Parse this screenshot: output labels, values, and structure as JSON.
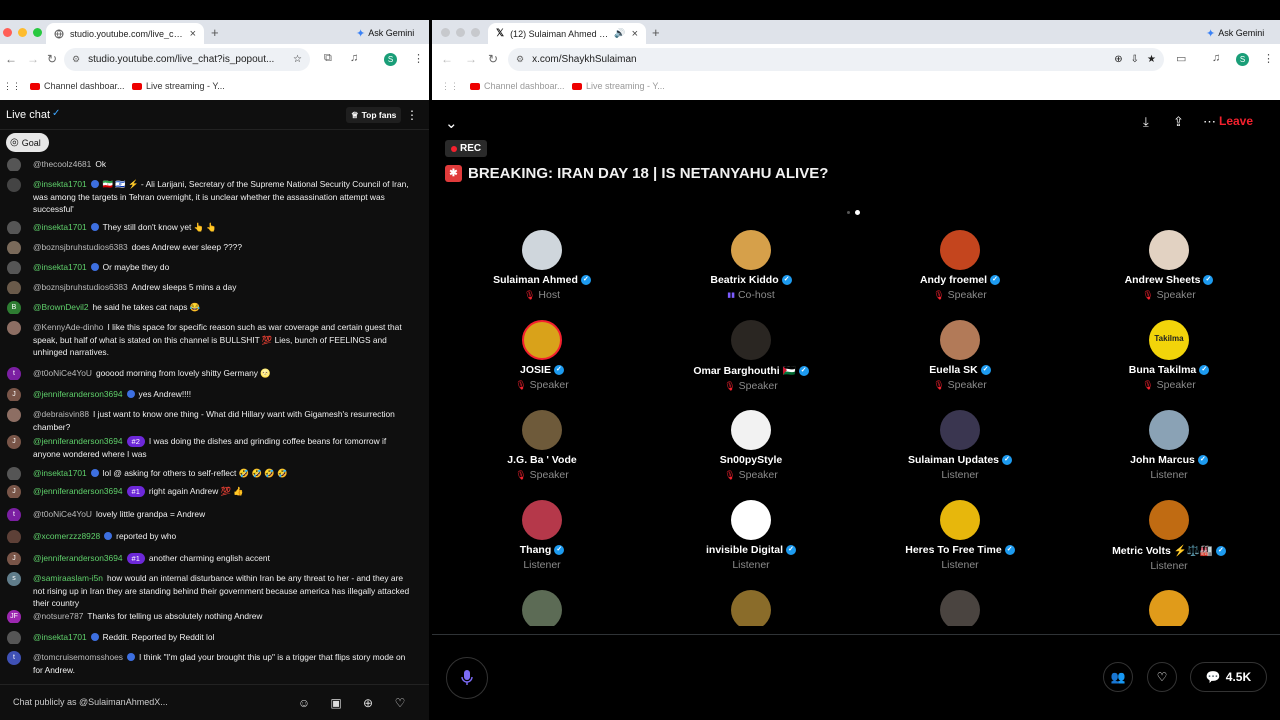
{
  "left_window": {
    "tab_title": "studio.youtube.com/live_chat",
    "ask_gemini": "Ask Gemini",
    "url": "studio.youtube.com/live_chat?is_popout...",
    "profile_initial": "S",
    "bookmarks": [
      "Channel dashboar...",
      "Live streaming - Y..."
    ],
    "chat_title": "Live chat",
    "top_fans": "Top fans",
    "goal": "Goal",
    "input_placeholder": "Chat publicly as @SulaimanAhmedX...",
    "messages": [
      {
        "initial": "",
        "author": "@thecoolz4681",
        "badge": "",
        "text": "Ok"
      },
      {
        "initial": "",
        "author": "@insekta1701",
        "badge": "",
        "text": "🇮🇷 🇮🇱 ⚡ - Ali Larijani, Secretary of the Supreme National Security Council of Iran, was among the targets in Tehran overnight, it is unclear whether the assassination attempt was successful'"
      },
      {
        "initial": "",
        "author": "@insekta1701",
        "badge": "",
        "text": "They still don't know yet 👆 👆"
      },
      {
        "initial": "",
        "author": "@boznsjbruhstudios6383",
        "badge": "",
        "text": "does Andrew ever sleep ????"
      },
      {
        "initial": "",
        "author": "@insekta1701",
        "badge": "",
        "text": "Or maybe they do"
      },
      {
        "initial": "",
        "author": "@boznsjbruhstudios6383",
        "badge": "",
        "text": "Andrew sleeps 5 mins a day"
      },
      {
        "initial": "B",
        "author": "@BrownDevil2",
        "badge": "",
        "text": "he said he takes cat naps 😂"
      },
      {
        "initial": "",
        "author": "@KennyAde-dinho",
        "badge": "",
        "text": "I like this space for specific reason such as war coverage and certain guest that speak, but half of what is stated on this channel is BULLSHIT 💯 Lies, bunch of FEELINGS and unhinged narratives."
      },
      {
        "initial": "t",
        "author": "@t0oNiCe4YoU",
        "badge": "",
        "text": "gooood morning from lovely shitty Germany 🌝"
      },
      {
        "initial": "J",
        "author": "@jenniferanderson3694",
        "badge": "",
        "text": "yes Andrew!!!!"
      },
      {
        "initial": "",
        "author": "@debraisvin88",
        "badge": "",
        "text": "I just want to know one thing - What did Hillary want with Gigamesh's resurrection chamber?"
      },
      {
        "initial": "J",
        "author": "@jenniferanderson3694",
        "badge": "#2",
        "text": "I was doing the dishes and grinding coffee beans for tomorrow if anyone wondered where I was"
      },
      {
        "initial": "",
        "author": "@insekta1701",
        "badge": "",
        "text": "lol @ asking for others to self-reflect 🤣 🤣 🤣 🤣"
      },
      {
        "initial": "J",
        "author": "@jenniferanderson3694",
        "badge": "#1",
        "text": "right again Andrew 💯 👍"
      },
      {
        "initial": "t",
        "author": "@t0oNiCe4YoU",
        "badge": "",
        "text": "lovely little grandpa = Andrew"
      },
      {
        "initial": "",
        "author": "@xcomerzzz8928",
        "badge": "",
        "text": "reported by who"
      },
      {
        "initial": "J",
        "author": "@jenniferanderson3694",
        "badge": "#1",
        "text": "another charming english accent"
      },
      {
        "initial": "s",
        "author": "@samiraaslam-i5n",
        "badge": "",
        "text": "how would an internal disturbance within Iran be any threat to her - and they are not rising up in Iran they are standing behind their government because america has illegally attacked their country"
      },
      {
        "initial": "JF",
        "author": "@notsure787",
        "badge": "",
        "text": "Thanks for telling us absolutely nothing Andrew"
      },
      {
        "initial": "",
        "author": "@insekta1701",
        "badge": "",
        "text": "Reddit. Reported by Reddit lol"
      },
      {
        "initial": "t",
        "author": "@tomcruisemomsshoes",
        "badge": "",
        "text": "I think \"I'm glad your brought this up\" is a trigger that flips story mode on for Andrew."
      }
    ]
  },
  "right_window": {
    "tab_title": "(12) Sulaiman Ahmed (@S",
    "ask_gemini": "Ask Gemini",
    "url": "x.com/ShaykhSulaiman",
    "profile_initial": "S",
    "bookmarks": [
      "Channel dashboar...",
      "Live streaming - Y..."
    ],
    "rec": "REC",
    "space_title": "BREAKING: IRAN DAY 18 | IS NETANYAHU ALIVE?",
    "leave": "Leave",
    "listener_count": "4.5K",
    "participants": [
      {
        "name": "Sulaiman Ahmed",
        "role": "Host",
        "verified": true,
        "role_icon": "mic",
        "avatar_color": "#cfd6dc"
      },
      {
        "name": "Beatrix Kiddo",
        "role": "Co-host",
        "verified": true,
        "role_icon": "eq",
        "avatar_color": "#d6a04a"
      },
      {
        "name": "Andy froemel",
        "role": "Speaker",
        "verified": true,
        "role_icon": "mic",
        "avatar_color": "#c4451e"
      },
      {
        "name": "Andrew Sheets",
        "role": "Speaker",
        "verified": true,
        "role_icon": "mic",
        "avatar_color": "#e2d2c2"
      },
      {
        "name": "JOSIE",
        "role": "Speaker",
        "verified": true,
        "role_icon": "mic",
        "avatar_color": "#d9a21a"
      },
      {
        "name": "Omar Barghouthi 🇵🇸",
        "role": "Speaker",
        "verified": true,
        "role_icon": "mic",
        "avatar_color": "#2a2622"
      },
      {
        "name": "Euella SK",
        "role": "Speaker",
        "verified": true,
        "role_icon": "mic",
        "avatar_color": "#b27a58"
      },
      {
        "name": "Buna Takilma",
        "role": "Speaker",
        "verified": true,
        "role_icon": "mic",
        "avatar_color": "#f2d40a",
        "avatar_text": "Takilma"
      },
      {
        "name": "J.G. Ba ' Vode",
        "role": "Speaker",
        "verified": false,
        "role_icon": "mic",
        "avatar_color": "#6e5a3a"
      },
      {
        "name": "Sn00pyStyle",
        "role": "Speaker",
        "verified": false,
        "role_icon": "mic",
        "avatar_color": "#f2f2f2"
      },
      {
        "name": "Sulaiman Updates",
        "role": "Listener",
        "verified": true,
        "role_icon": "",
        "avatar_color": "#3a3650"
      },
      {
        "name": "John Marcus",
        "role": "Listener",
        "verified": true,
        "role_icon": "",
        "avatar_color": "#8aa2b5"
      },
      {
        "name": "Thang",
        "role": "Listener",
        "verified": true,
        "role_icon": "",
        "avatar_color": "#b5384a"
      },
      {
        "name": "invisible Digital",
        "role": "Listener",
        "verified": true,
        "role_icon": "",
        "avatar_color": "#ffffff"
      },
      {
        "name": "Heres To Free Time",
        "role": "Listener",
        "verified": true,
        "role_icon": "",
        "avatar_color": "#e7b70c"
      },
      {
        "name": "Metric Volts ⚡⚖️🏭",
        "role": "Listener",
        "verified": true,
        "role_icon": "",
        "avatar_color": "#c06b12"
      },
      {
        "name": "",
        "role": "",
        "verified": false,
        "role_icon": "",
        "avatar_color": "#5c6b55"
      },
      {
        "name": "",
        "role": "",
        "verified": false,
        "role_icon": "",
        "avatar_color": "#8a6c2a"
      },
      {
        "name": "",
        "role": "",
        "verified": false,
        "role_icon": "",
        "avatar_color": "#4a4440"
      },
      {
        "name": "",
        "role": "",
        "verified": false,
        "role_icon": "",
        "avatar_color": "#e09b1a"
      }
    ]
  }
}
